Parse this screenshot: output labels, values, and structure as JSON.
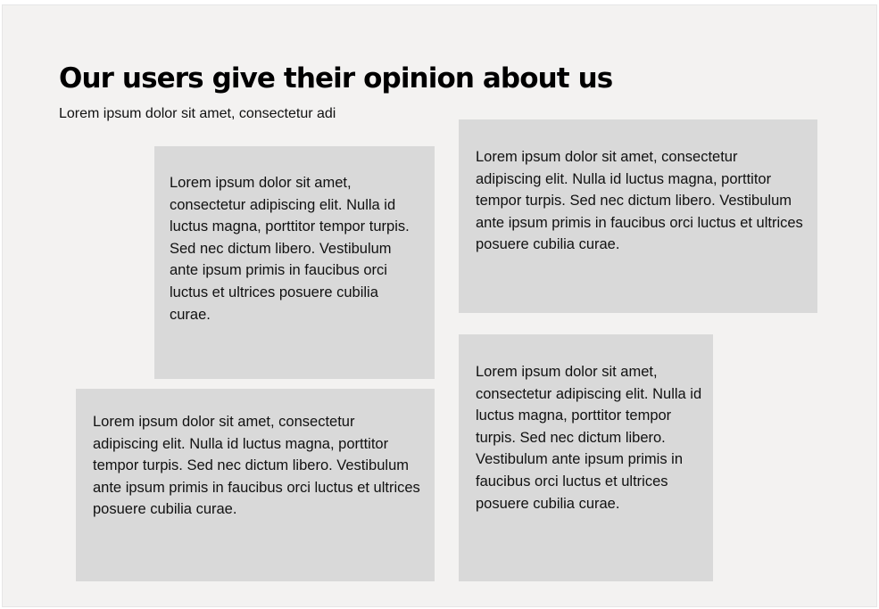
{
  "header": {
    "title": "Our users give their opinion about us",
    "subtitle": "Lorem ipsum dolor sit amet, consectetur adi"
  },
  "testimonials": [
    {
      "text": "Lorem ipsum dolor sit amet, consectetur adipiscing elit. Nulla id luctus magna, porttitor tempor turpis. Sed nec dictum libero. Vestibulum ante ipsum primis in faucibus orci luctus et ultrices posuere cubilia curae."
    },
    {
      "text": "Lorem ipsum dolor sit amet, consectetur adipiscing elit. Nulla id luctus magna, porttitor tempor turpis. Sed nec dictum libero. Vestibulum ante ipsum primis in faucibus orci luctus et ultrices posuere cubilia curae."
    },
    {
      "text": "Lorem ipsum dolor sit amet, consectetur adipiscing elit. Nulla id luctus magna, porttitor tempor turpis. Sed nec dictum libero. Vestibulum ante ipsum primis in faucibus orci luctus et ultrices posuere cubilia curae."
    },
    {
      "text": "Lorem ipsum dolor sit amet, consectetur adipiscing elit. Nulla id luctus magna, porttitor tempor turpis. Sed nec dictum libero. Vestibulum ante ipsum primis in faucibus orci luctus et ultrices posuere cubilia curae."
    }
  ],
  "colors": {
    "background": "#f3f2f1",
    "card": "#d9d9d9",
    "text": "#000000"
  }
}
